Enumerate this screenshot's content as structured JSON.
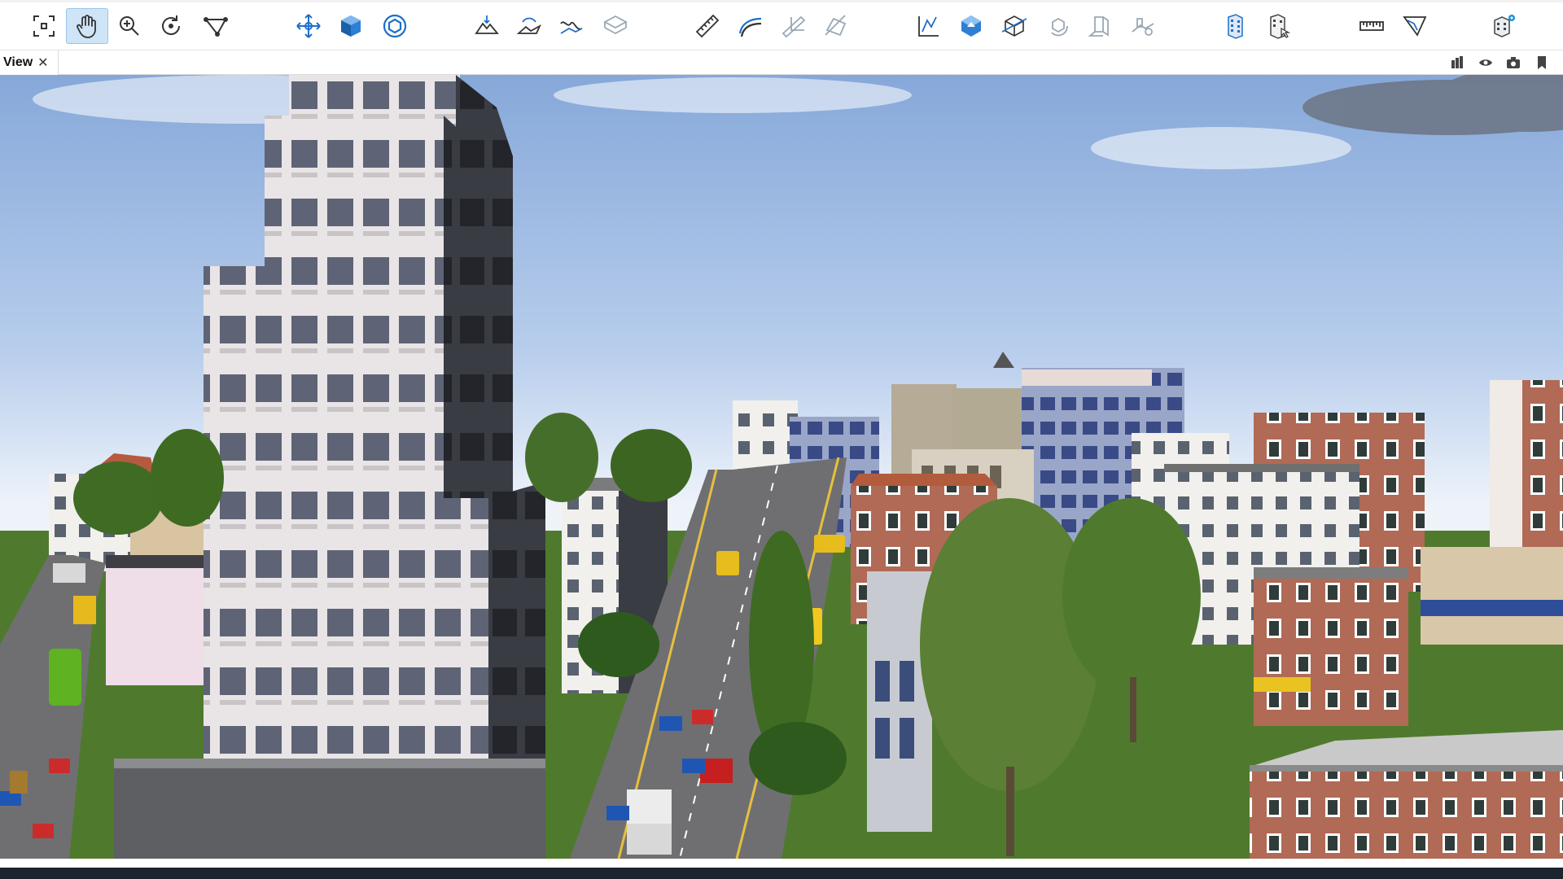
{
  "toolbar": {
    "tools": [
      {
        "name": "fit-extent-icon"
      },
      {
        "name": "pan-hand-icon",
        "active": true
      },
      {
        "name": "zoom-icon"
      },
      {
        "name": "rotate-orbit-icon"
      },
      {
        "name": "select-polygon-icon"
      },
      {
        "name": "move-navigate-icon"
      },
      {
        "name": "cube-view-icon"
      },
      {
        "name": "globe-view-icon"
      },
      {
        "name": "terrain-flatten-icon"
      },
      {
        "name": "terrain-raise-icon"
      },
      {
        "name": "terrain-smooth-icon"
      },
      {
        "name": "terrain-layer-icon"
      },
      {
        "name": "measure-distance-icon"
      },
      {
        "name": "measure-path-icon"
      },
      {
        "name": "measure-height-icon"
      },
      {
        "name": "measure-area-icon"
      },
      {
        "name": "profile-analysis-icon"
      },
      {
        "name": "volume-analysis-icon"
      },
      {
        "name": "box-clip-icon"
      },
      {
        "name": "rotate-model-icon"
      },
      {
        "name": "shadow-analysis-icon"
      },
      {
        "name": "terrain-cut-icon"
      },
      {
        "name": "building-select-icon"
      },
      {
        "name": "building-query-icon"
      },
      {
        "name": "ruler-icon"
      },
      {
        "name": "flight-route-icon"
      },
      {
        "name": "model-settings-icon"
      }
    ]
  },
  "view_tab": {
    "label": "View",
    "close": "✕"
  },
  "view_buttons": [
    {
      "name": "layers-icon"
    },
    {
      "name": "eye-icon"
    },
    {
      "name": "camera-icon"
    },
    {
      "name": "bookmark-icon"
    }
  ],
  "colors": {
    "accent": "#1e6fc8",
    "active_tool_bg": "#cfe4f7",
    "sky_top": "#8fb0df",
    "sky_horizon": "#eef3fa",
    "grass": "#4f7a2e",
    "road": "#6f6f72",
    "status_bar": "#1c2430"
  }
}
